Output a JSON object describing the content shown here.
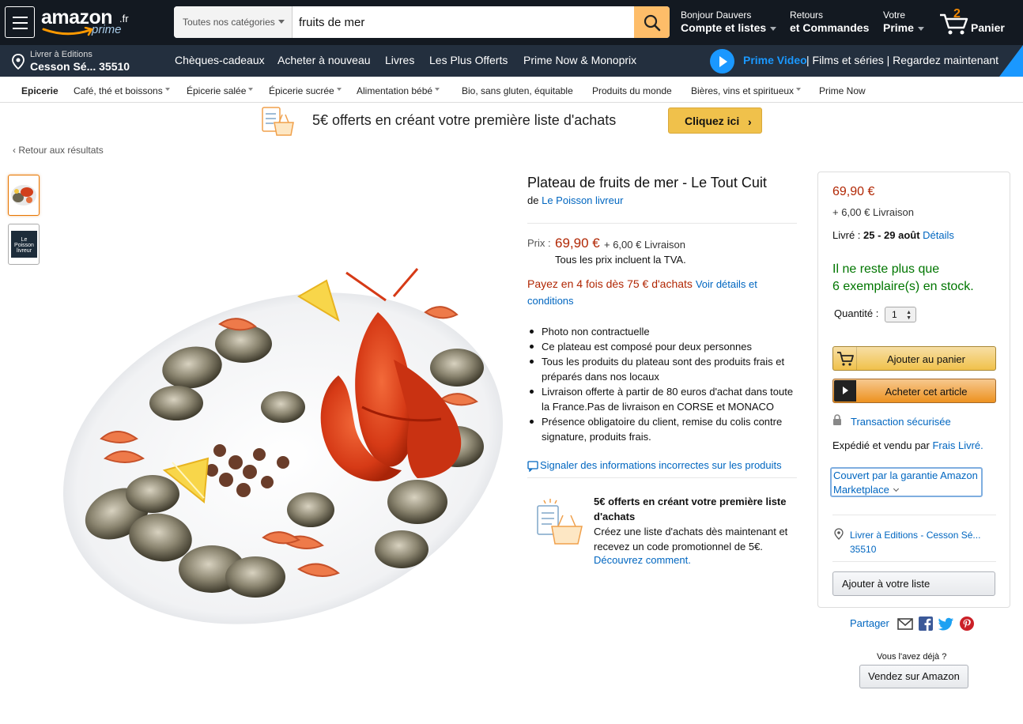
{
  "header": {
    "logo_text": "amazon",
    "logo_tld": ".fr",
    "logo_prime": "prime",
    "search": {
      "category": "Toutes nos catégories",
      "query": "fruits de mer"
    },
    "greeting": {
      "line1": "Bonjour Dauvers",
      "line2": "Compte et listes"
    },
    "orders": {
      "line1": "Retours",
      "line2": "et Commandes"
    },
    "prime": {
      "line1": "Votre",
      "line2": "Prime"
    },
    "cart": {
      "count": "2",
      "label": "Panier"
    }
  },
  "mainnav": {
    "deliver": {
      "line1": "Livrer à Editions",
      "line2": "Cesson Sé... 35510"
    },
    "links": [
      "Chèques-cadeaux",
      "Acheter à nouveau",
      "Livres",
      "Les Plus Offerts",
      "Prime Now & Monoprix"
    ],
    "prime_video": {
      "label": "Prime Video",
      "rest": "| Films et séries | Regardez maintenant"
    }
  },
  "subnav": {
    "items": [
      "Epicerie",
      "Café, thé et boissons",
      "Épicerie salée",
      "Épicerie sucrée",
      "Alimentation bébé",
      "Bio, sans gluten, équitable",
      "Produits du monde",
      "Bières, vins et spiritueux",
      "Prime Now"
    ]
  },
  "banner": {
    "text": "5€ offerts en créant votre première liste d'achats",
    "button": "Cliquez ici"
  },
  "back_link": "Retour aux résultats",
  "thumbnail2_text": "Le Poisson livreur",
  "product": {
    "title": "Plateau de fruits de mer - Le Tout Cuit",
    "by": "de",
    "brand": "Le Poisson livreur",
    "price_label": "Prix :",
    "price": "69,90 €",
    "shipping": "+ 6,00 € Livraison",
    "tva": "Tous les prix incluent la TVA.",
    "pay4_text": "Payez en 4 fois dès 75 € d'achats",
    "pay4_link": "Voir détails et conditions",
    "bullets": [
      "Photo non contractuelle",
      "Ce plateau est composé pour deux personnes",
      "Tous les produits du plateau sont des produits frais et préparés dans nos locaux",
      "Livraison offerte à partir de 80 euros d'achat dans toute la France.Pas de livraison en CORSE et MONACO",
      "Présence obligatoire du client, remise du colis contre signature, produits frais."
    ],
    "report_link": "Signaler des informations incorrectes sur les produits",
    "promo": {
      "title": "5€ offerts en créant votre première liste d'achats",
      "body": "Créez une liste d'achats dès maintenant et recevez un code promotionnel de 5€.",
      "link": "Découvrez comment."
    }
  },
  "buybox": {
    "price": "69,90 €",
    "shipping": "+ 6,00 € Livraison",
    "delivery_label": "Livré : ",
    "delivery_dates": "25 - 29 août",
    "delivery_details": "Détails",
    "stock_line1": "Il ne reste plus que",
    "stock_line2": "6 exemplaire(s) en stock.",
    "qty_label": "Quantité :",
    "qty_value": "1",
    "add_to_cart": "Ajouter au panier",
    "buy_now": "Acheter cet article",
    "secure": "Transaction sécurisée",
    "sold_by_prefix": "Expédié et vendu par ",
    "seller": "Frais Livré.",
    "guarantee": "Couvert par la garantie Amazon Marketplace",
    "address": "Livrer à Editions - Cesson Sé... 35510",
    "add_to_list": "Ajouter à votre liste"
  },
  "share": {
    "label": "Partager"
  },
  "sell": {
    "question": "Vous l'avez déjà ?",
    "button": "Vendez sur Amazon"
  },
  "colors": {
    "nav_dark": "#131921",
    "nav_mid": "#232f3e",
    "price_red": "#b12704",
    "stock_green": "#007600",
    "link_blue": "#0066c0",
    "button_yellow": "#f0c14b",
    "button_orange": "#ed9220"
  }
}
